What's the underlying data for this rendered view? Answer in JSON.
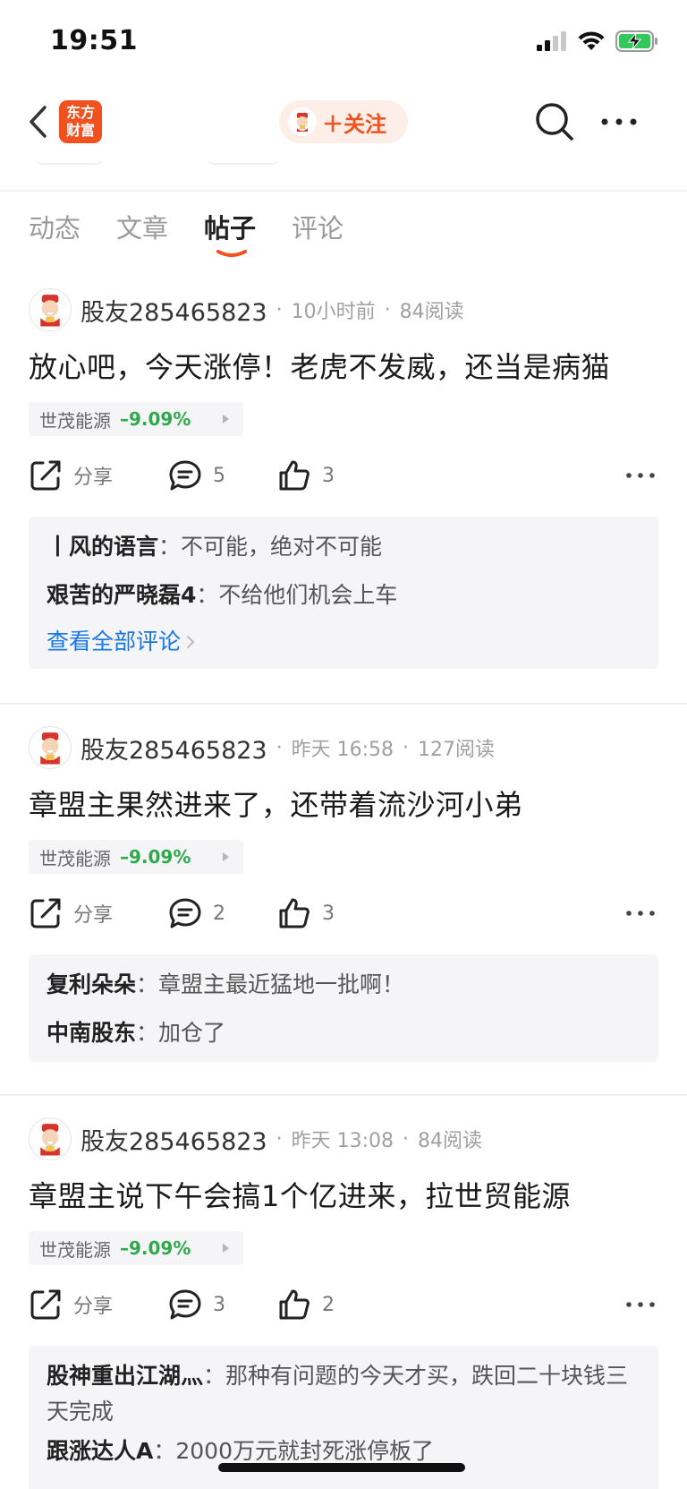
{
  "status_bar": {
    "time": "19:51"
  },
  "nav": {
    "logo_line1": "东方",
    "logo_line2": "财富",
    "follow_label": "＋关注"
  },
  "tabs": [
    {
      "label": "动态",
      "active": false
    },
    {
      "label": "文章",
      "active": false
    },
    {
      "label": "帖子",
      "active": true
    },
    {
      "label": "评论",
      "active": false
    }
  ],
  "posts": [
    {
      "username": "股友285465823",
      "time": "10小时前",
      "reads": "84阅读",
      "title": "放心吧，今天涨停！老虎不发威，还当是病猫",
      "stock_name": "世茂能源",
      "stock_change": "–9.09%",
      "share_label": "分享",
      "comment_count": "5",
      "like_count": "3",
      "comments": [
        {
          "user": "丨风的语言",
          "text": "：不可能，绝对不可能"
        },
        {
          "user": "艰苦的严晓磊4",
          "text": "：不给他们机会上车"
        }
      ],
      "view_all": "查看全部评论"
    },
    {
      "username": "股友285465823",
      "time": "昨天 16:58",
      "reads": "127阅读",
      "title": "章盟主果然进来了，还带着流沙河小弟",
      "stock_name": "世茂能源",
      "stock_change": "–9.09%",
      "share_label": "分享",
      "comment_count": "2",
      "like_count": "3",
      "comments": [
        {
          "user": "复利朵朵",
          "text": "：章盟主最近猛地一批啊！"
        },
        {
          "user": "中南股东",
          "text": "：加仓了"
        }
      ]
    },
    {
      "username": "股友285465823",
      "time": "昨天 13:08",
      "reads": "84阅读",
      "title": "章盟主说下午会搞1个亿进来，拉世贸能源",
      "stock_name": "世茂能源",
      "stock_change": "–9.09%",
      "share_label": "分享",
      "comment_count": "3",
      "like_count": "2",
      "comments": [
        {
          "user": "股神重出江湖灬",
          "text": "：那种有问题的今天才买，跌回二十块钱三天完成"
        },
        {
          "user": "跟涨达人A",
          "text": "：2000万元就封死涨停板了"
        }
      ]
    }
  ]
}
